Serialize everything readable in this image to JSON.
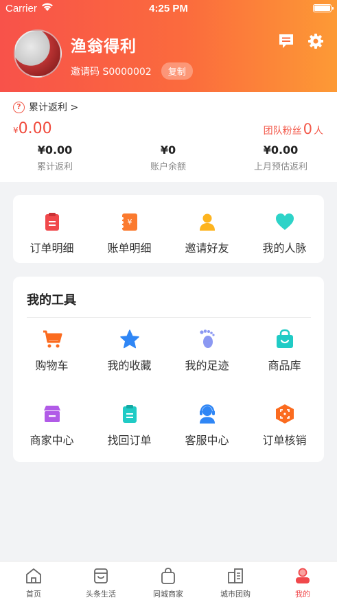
{
  "status_bar": {
    "carrier": "Carrier",
    "time": "4:25 PM"
  },
  "profile": {
    "nickname": "渔翁得利",
    "invite_code": "邀请码 S0000002",
    "copy_label": "复制"
  },
  "rebate": {
    "cumulative_link": "累计返利 >",
    "total_symbol": "¥",
    "total_value": "0.00",
    "fans_label": "团队粉丝",
    "fans_count": "0",
    "fans_unit": "人",
    "stats": [
      {
        "value": "¥0.00",
        "label": "累计返利"
      },
      {
        "value": "¥0",
        "label": "账户余额"
      },
      {
        "value": "¥0.00",
        "label": "上月预估返利"
      }
    ]
  },
  "quick_links": [
    {
      "label": "订单明细",
      "icon": "order-detail-icon"
    },
    {
      "label": "账单明细",
      "icon": "bill-detail-icon"
    },
    {
      "label": "邀请好友",
      "icon": "invite-friend-icon"
    },
    {
      "label": "我的人脉",
      "icon": "heart-icon"
    }
  ],
  "tools": {
    "title": "我的工具",
    "items": [
      {
        "label": "购物车",
        "icon": "cart-icon"
      },
      {
        "label": "我的收藏",
        "icon": "star-icon"
      },
      {
        "label": "我的足迹",
        "icon": "footprint-icon"
      },
      {
        "label": "商品库",
        "icon": "bag-icon"
      },
      {
        "label": "商家中心",
        "icon": "store-icon"
      },
      {
        "label": "找回订单",
        "icon": "retrieve-order-icon"
      },
      {
        "label": "客服中心",
        "icon": "customer-service-icon"
      },
      {
        "label": "订单核销",
        "icon": "scan-icon"
      }
    ]
  },
  "tabs": [
    {
      "label": "首页",
      "icon": "home-icon"
    },
    {
      "label": "头条生活",
      "icon": "shop-icon"
    },
    {
      "label": "同城商家",
      "icon": "shopping-bag-icon"
    },
    {
      "label": "城市团购",
      "icon": "building-icon"
    },
    {
      "label": "我的",
      "icon": "profile-icon",
      "active": true
    }
  ],
  "colors": {
    "header_start": "#f8524a",
    "header_end": "#fd9a35",
    "accent": "#f0484b"
  }
}
